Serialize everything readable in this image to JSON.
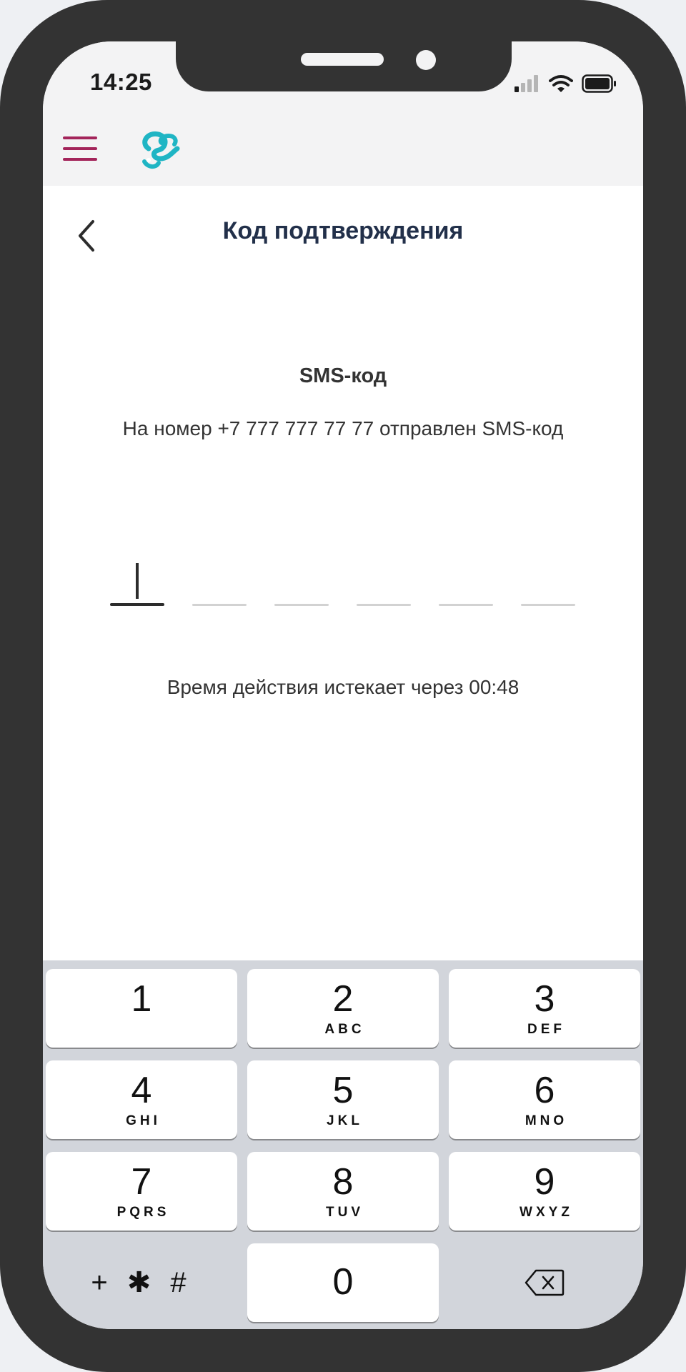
{
  "status_bar": {
    "time": "14:25",
    "icons": [
      "cellular-signal-icon",
      "wifi-icon",
      "battery-icon"
    ]
  },
  "app_header": {
    "menu_icon": "hamburger-menu-icon",
    "logo_icon": "brand-logo-icon",
    "menu_color": "#a3245a",
    "logo_color": "#1fb5c4"
  },
  "page": {
    "title": "Код подтверждения",
    "back_icon": "chevron-left-icon"
  },
  "sms": {
    "title": "SMS-код",
    "subtitle": "На номер +7 777 777 77 77 отправлен SMS-код",
    "code_length": 6,
    "timer_text": "Время действия истекает через 00:48"
  },
  "keyboard": {
    "keys": [
      {
        "num": "1",
        "letters": ""
      },
      {
        "num": "2",
        "letters": "ABC"
      },
      {
        "num": "3",
        "letters": "DEF"
      },
      {
        "num": "4",
        "letters": "GHI"
      },
      {
        "num": "5",
        "letters": "JKL"
      },
      {
        "num": "6",
        "letters": "MNO"
      },
      {
        "num": "7",
        "letters": "PQRS"
      },
      {
        "num": "8",
        "letters": "TUV"
      },
      {
        "num": "9",
        "letters": "WXYZ"
      }
    ],
    "symbols": "+ ✱ #",
    "zero": "0",
    "delete_icon": "backspace-icon"
  }
}
